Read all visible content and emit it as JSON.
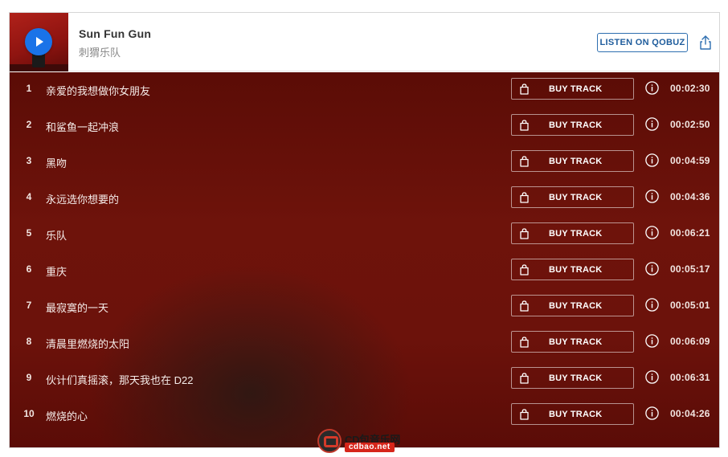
{
  "album": {
    "title": "Sun Fun Gun",
    "artist": "刺猬乐队"
  },
  "actions": {
    "listen_label": "LISTEN ON QOBUZ",
    "buy_label": "BUY TRACK",
    "icons": {
      "play": "play-icon",
      "share": "share-icon",
      "buy": "shopping-bag-icon",
      "info": "info-icon"
    }
  },
  "tracks": [
    {
      "num": "1",
      "title": "亲爱的我想做你女朋友",
      "duration": "00:02:30"
    },
    {
      "num": "2",
      "title": "和鲨鱼一起冲浪",
      "duration": "00:02:50"
    },
    {
      "num": "3",
      "title": "黑吻",
      "duration": "00:04:59"
    },
    {
      "num": "4",
      "title": "永远选你想要的",
      "duration": "00:04:36"
    },
    {
      "num": "5",
      "title": "乐队",
      "duration": "00:06:21"
    },
    {
      "num": "6",
      "title": "重庆",
      "duration": "00:05:17"
    },
    {
      "num": "7",
      "title": "最寂寞的一天",
      "duration": "00:05:01"
    },
    {
      "num": "8",
      "title": "清晨里燃烧的太阳",
      "duration": "00:06:09"
    },
    {
      "num": "9",
      "title": "伙计们真摇滚，那天我也在 D22",
      "duration": "00:06:31"
    },
    {
      "num": "10",
      "title": "燃烧的心",
      "duration": "00:04:26"
    }
  ],
  "watermark": {
    "line1": "CD包音乐网",
    "line2": "cdbao.net"
  },
  "colors": {
    "accent_blue": "#1a73e8",
    "qobuz_blue": "#1e5c9c",
    "track_bg": "#6c120b"
  }
}
